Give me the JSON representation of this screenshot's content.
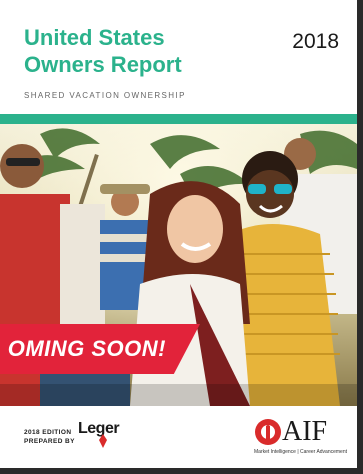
{
  "report": {
    "title_line1": "United States",
    "title_line2": "Owners Report",
    "year": "2018",
    "subtitle": "SHARED VACATION OWNERSHIP"
  },
  "banner": {
    "text": "OMING SOON!"
  },
  "footer": {
    "edition_line1": "2018 EDITION",
    "edition_line2": "PREPARED BY",
    "leger_logo": "Leger",
    "aif_logo": "AIF",
    "aif_tagline": "Market Intelligence | Career Advancement"
  },
  "colors": {
    "accent_teal": "#2bb28c",
    "banner_red": "#e2233a",
    "logo_red": "#d92b2b"
  }
}
